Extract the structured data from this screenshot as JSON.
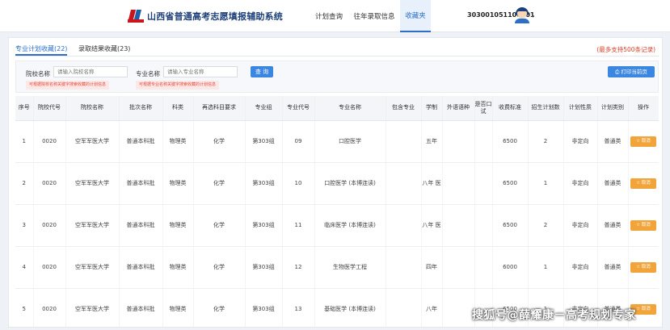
{
  "header": {
    "system_title": "山西省普通高考志愿填报辅助系统",
    "nav": [
      {
        "label": "计划查询",
        "active": false
      },
      {
        "label": "往年录取信息",
        "active": false
      },
      {
        "label": "收藏夹",
        "active": true
      }
    ],
    "user_id": "303001051100001",
    "dropdown_caret": "▾"
  },
  "tabs": [
    {
      "label": "专业计划收藏(22)",
      "active": true
    },
    {
      "label": "录取结果收藏(23)",
      "active": false
    }
  ],
  "max_note": "(最多支持500条记录)",
  "filter": {
    "school_label": "院校名称",
    "school_placeholder": "请输入院校名称",
    "school_tip": "可根据院校名称关键字搜索收藏的计划信息",
    "major_label": "专业名称",
    "major_placeholder": "请输入专业名称",
    "major_tip": "可根据专业名称关键字搜索收藏的计划信息",
    "search_label": "查 询",
    "print_label": "打印当前页"
  },
  "table": {
    "columns": [
      "序号",
      "院校代号",
      "院校名称",
      "批次名称",
      "科类",
      "再选科目要求",
      "专业组",
      "专业代号",
      "专业名称",
      "包含专业",
      "学制",
      "外语语种",
      "是否口试",
      "收费标准",
      "招生计划数",
      "计划性质",
      "计划类别",
      "操作"
    ],
    "rows": [
      {
        "no": "1",
        "code": "0020",
        "school": "空军军医大学",
        "batch": "普通本科批",
        "category": "物理类",
        "subject": "化学",
        "group": "第303组",
        "major_code": "09",
        "major": "口腔医学",
        "includes": "",
        "length": "五年",
        "language": "",
        "oral": "",
        "fee": "6500",
        "plan": "2",
        "nature": "非定向",
        "type": "普通类",
        "action": "取消"
      },
      {
        "no": "2",
        "code": "0020",
        "school": "空军军医大学",
        "batch": "普通本科批",
        "category": "物理类",
        "subject": "化学",
        "group": "第303组",
        "major_code": "10",
        "major": "口腔医学 (本博连读)",
        "includes": "",
        "length": "八年 医",
        "language": "",
        "oral": "",
        "fee": "6500",
        "plan": "1",
        "nature": "非定向",
        "type": "普通类",
        "action": "取消"
      },
      {
        "no": "3",
        "code": "0020",
        "school": "空军军医大学",
        "batch": "普通本科批",
        "category": "物理类",
        "subject": "化学",
        "group": "第303组",
        "major_code": "11",
        "major": "临床医学 (本博连读)",
        "includes": "",
        "length": "八年 医",
        "language": "",
        "oral": "",
        "fee": "6500",
        "plan": "2",
        "nature": "非定向",
        "type": "普通类",
        "action": "取消"
      },
      {
        "no": "4",
        "code": "0020",
        "school": "空军军医大学",
        "batch": "普通本科批",
        "category": "物理类",
        "subject": "化学",
        "group": "第303组",
        "major_code": "12",
        "major": "生物医学工程",
        "includes": "",
        "length": "四年",
        "language": "",
        "oral": "",
        "fee": "6000",
        "plan": "1",
        "nature": "非定向",
        "type": "普通类",
        "action": "取消"
      },
      {
        "no": "5",
        "code": "0020",
        "school": "空军军医大学",
        "batch": "普通本科批",
        "category": "物理类",
        "subject": "化学",
        "group": "第303组",
        "major_code": "13",
        "major": "基础医学 (本博连读)",
        "includes": "",
        "length": "八年",
        "language": "",
        "oral": "",
        "fee": "6500",
        "plan": "1",
        "nature": "非定向",
        "type": "普通类",
        "action": "取消"
      }
    ]
  },
  "watermark": "搜狐号@薛耀康－高考规划专家",
  "colors": {
    "accent": "#2b6fc9",
    "button_blue": "#3a86e0",
    "cancel_orange": "#f0a43a",
    "warning_red": "#e0412a"
  }
}
